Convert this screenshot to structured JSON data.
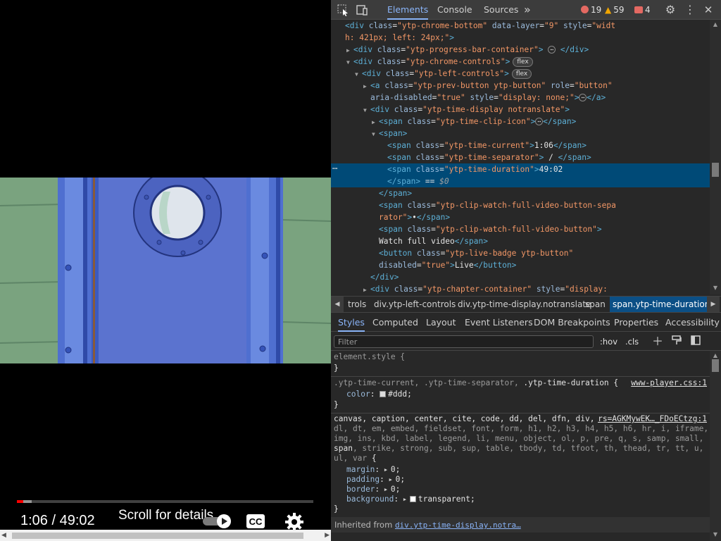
{
  "player": {
    "close_glyph": "✕",
    "progress": {
      "played_fraction": 0.0225,
      "loaded_fraction": 0.05,
      "played_color": "#ff0000"
    },
    "time_current": "1:06",
    "time_separator": " / ",
    "time_duration": "49:02",
    "scroll_hint": "Scroll for details",
    "buttons": {
      "autoplay": "autoplay-toggle",
      "captions": "CC",
      "settings": "settings-gear"
    }
  },
  "devtools": {
    "toolbar": {
      "tabs": [
        "Elements",
        "Console",
        "Sources"
      ],
      "more_tabs_glyph": "»",
      "errors": "19",
      "warnings": "59",
      "issues": "4",
      "colors": {
        "error": "#e46962",
        "warning": "#f2a600",
        "issue": "#e46962",
        "accent": "#8ab4f8"
      }
    },
    "dom_lines": [
      {
        "indent": 0,
        "tri": "",
        "html": "<span class=\"tg\">&lt;div</span> <span class=\"an\">class</span>=<span class=\"av\">\"ytp-chrome-bottom\"</span> <span class=\"an\">data-layer</span>=<span class=\"av\">\"9\"</span> <span class=\"an\">style</span>=<span class=\"av\">\"widt</span>"
      },
      {
        "indent": 0,
        "tri": "",
        "html": "<span class=\"av\">h: 421px; left: 24px;\"</span><span class=\"tg\">&gt;</span>"
      },
      {
        "indent": 1,
        "tri": "▶",
        "html": "<span class=\"tg\">&lt;div</span> <span class=\"an\">class</span>=<span class=\"av\">\"ytp-progress-bar-container\"</span><span class=\"tg\">&gt;</span> <span class=\"ell\">⋯</span> <span class=\"tg\">&lt;/div&gt;</span>"
      },
      {
        "indent": 1,
        "tri": "▼",
        "html": "<span class=\"tg\">&lt;div</span> <span class=\"an\">class</span>=<span class=\"av\">\"ytp-chrome-controls\"</span><span class=\"tg\">&gt;</span><span class=\"badge\">flex</span>"
      },
      {
        "indent": 2,
        "tri": "▼",
        "html": "<span class=\"tg\">&lt;div</span> <span class=\"an\">class</span>=<span class=\"av\">\"ytp-left-controls\"</span><span class=\"tg\">&gt;</span><span class=\"badge\">flex</span>"
      },
      {
        "indent": 3,
        "tri": "▶",
        "html": "<span class=\"tg\">&lt;a</span> <span class=\"an\">class</span>=<span class=\"av\">\"ytp-prev-button ytp-button\"</span> <span class=\"an\">role</span>=<span class=\"av\">\"button\"</span>"
      },
      {
        "indent": 3,
        "tri": "",
        "html": "<span class=\"an\">aria-disabled</span>=<span class=\"av\">\"true\"</span> <span class=\"an\">style</span>=<span class=\"av\">\"display: none;\"</span><span class=\"tg\">&gt;</span><span class=\"ell\">⋯</span><span class=\"tg\">&lt;/a&gt;</span>"
      },
      {
        "indent": 3,
        "tri": "▼",
        "html": "<span class=\"tg\">&lt;div</span> <span class=\"an\">class</span>=<span class=\"av\">\"ytp-time-display notranslate\"</span><span class=\"tg\">&gt;</span>"
      },
      {
        "indent": 4,
        "tri": "▶",
        "html": "<span class=\"tg\">&lt;span</span> <span class=\"an\">class</span>=<span class=\"av\">\"ytp-time-clip-icon\"</span><span class=\"tg\">&gt;</span><span class=\"ell\">⋯</span><span class=\"tg\">&lt;/span&gt;</span>"
      },
      {
        "indent": 4,
        "tri": "▼",
        "html": "<span class=\"tg\">&lt;span&gt;</span>"
      },
      {
        "indent": 5,
        "tri": "",
        "html": "<span class=\"tg\">&lt;span</span> <span class=\"an\">class</span>=<span class=\"av\">\"ytp-time-current\"</span><span class=\"tg\">&gt;</span>1:06<span class=\"tg\">&lt;/span&gt;</span>"
      },
      {
        "indent": 5,
        "tri": "",
        "html": "<span class=\"tg\">&lt;span</span> <span class=\"an\">class</span>=<span class=\"av\">\"ytp-time-separator\"</span><span class=\"tg\">&gt;</span> / <span class=\"tg\">&lt;/span&gt;</span>"
      },
      {
        "indent": 5,
        "tri": "",
        "selected": true,
        "html": "<span class=\"tg\">&lt;span</span> <span class=\"an\">class</span>=<span class=\"av\">\"ytp-time-duration\"</span><span class=\"tg\">&gt;</span>49:02"
      },
      {
        "indent": 5,
        "tri": "",
        "selected": true,
        "html": "<span class=\"tg\">&lt;/span&gt;</span> == <span class=\"dollar\">$0</span>"
      },
      {
        "indent": 4,
        "tri": "",
        "html": "<span class=\"tg\">&lt;/span&gt;</span>"
      },
      {
        "indent": 4,
        "tri": "",
        "html": "<span class=\"tg\">&lt;span</span> <span class=\"an\">class</span>=<span class=\"av\">\"ytp-clip-watch-full-video-button-sepa</span>"
      },
      {
        "indent": 4,
        "tri": "",
        "html": "<span class=\"av\">rator\"</span><span class=\"tg\">&gt;</span>•<span class=\"tg\">&lt;/span&gt;</span>"
      },
      {
        "indent": 4,
        "tri": "",
        "html": "<span class=\"tg\">&lt;span</span> <span class=\"an\">class</span>=<span class=\"av\">\"ytp-clip-watch-full-video-button\"</span><span class=\"tg\">&gt;</span>"
      },
      {
        "indent": 4,
        "tri": "",
        "html": "Watch full video<span class=\"tg\">&lt;/span&gt;</span>"
      },
      {
        "indent": 4,
        "tri": "",
        "html": "<span class=\"tg\">&lt;button</span> <span class=\"an\">class</span>=<span class=\"av\">\"ytp-live-badge ytp-button\"</span>"
      },
      {
        "indent": 4,
        "tri": "",
        "html": "<span class=\"an\">disabled</span>=<span class=\"av\">\"true\"</span><span class=\"tg\">&gt;</span>Live<span class=\"tg\">&lt;/button&gt;</span>"
      },
      {
        "indent": 3,
        "tri": "",
        "html": "<span class=\"tg\">&lt;/div&gt;</span>"
      },
      {
        "indent": 3,
        "tri": "▶",
        "html": "<span class=\"tg\">&lt;div</span> <span class=\"an\">class</span>=<span class=\"av\">\"ytp-chapter-container\"</span> <span class=\"an\">style</span>=<span class=\"av\">\"display:</span>"
      },
      {
        "indent": 3,
        "tri": "",
        "html": "<span class=\"av\">none;\"</span><span class=\"tg\">&gt;</span><span class=\"ell\">⋯</span><span class=\"tg\">&lt;/div&gt;</span>"
      }
    ],
    "breadcrumbs": [
      "trols",
      "div.ytp-left-controls",
      "div.ytp-time-display.notranslate",
      "span",
      "span.ytp-time-duration"
    ],
    "styles_tabs": [
      "Styles",
      "Computed",
      "Layout",
      "Event Listeners",
      "DOM Breakpoints",
      "Properties",
      "Accessibility"
    ],
    "filter": {
      "placeholder": "Filter",
      "hov": ":hov",
      "cls": ".cls"
    },
    "styles": {
      "element_style": "element.style {",
      "close_brace": "}",
      "rule1": {
        "selector_dim": ".ytp-time-current, .ytp-time-separator, ",
        "selector_bright": ".ytp-time-duration",
        "open": " {",
        "source": "www-player.css:1",
        "prop": "color",
        "value": "#ddd",
        "swatch": "#dddddd"
      },
      "rule2": {
        "source": "rs=AGKMywEK…_FDoECtzg:1",
        "sel_lines": [
          "canvas, caption, center, cite, code, dd, del, dfn, div,",
          "dl, dt, em, embed, fieldset, font, form, h1, h2, h3, h4, h5, h6, hr, i, iframe,",
          "img, ins, kbd, label, legend, li, menu, object, ol, p, pre, q, s, samp, small,"
        ],
        "sel_span": "span",
        "sel_line4_rest": ", strike, strong, sub, sup, table, tbody, td, tfoot, th, thead, tr, tt, u,",
        "sel_line5": "ul, var",
        "open": " {",
        "props": [
          {
            "name": "margin",
            "value": "0"
          },
          {
            "name": "padding",
            "value": "0"
          },
          {
            "name": "border",
            "value": "0"
          },
          {
            "name": "background",
            "value": "transparent"
          }
        ]
      },
      "inherited_label": "Inherited from ",
      "inherited_link": "div.ytp-time-display.notra…"
    }
  }
}
